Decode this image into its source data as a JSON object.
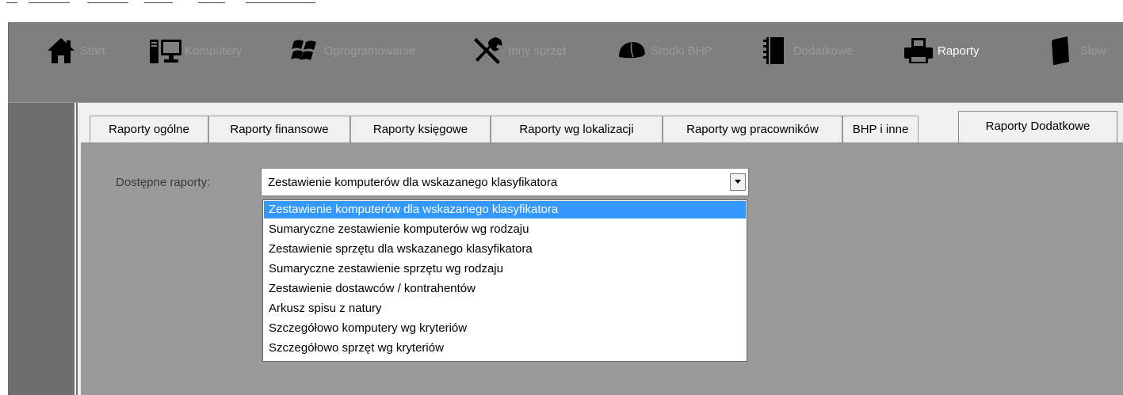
{
  "toolbar": {
    "items": [
      {
        "label": "Start",
        "icon": "home-icon",
        "active": false
      },
      {
        "label": "Komputery",
        "icon": "computer-icon",
        "active": false
      },
      {
        "label": "Oprogramowanie",
        "icon": "windows-icon",
        "active": false
      },
      {
        "label": "Inny sprzęt",
        "icon": "tools-icon",
        "active": false
      },
      {
        "label": "Środki BHP",
        "icon": "helmet-icon",
        "active": false
      },
      {
        "label": "Dodatkowe",
        "icon": "notebook-icon",
        "active": false
      },
      {
        "label": "Raporty",
        "icon": "printer-icon",
        "active": true
      },
      {
        "label": "Słow",
        "icon": "book-icon",
        "active": false
      }
    ]
  },
  "tabs": [
    {
      "label": "Raporty ogólne",
      "active": false
    },
    {
      "label": "Raporty finansowe",
      "active": false
    },
    {
      "label": "Raporty księgowe",
      "active": false
    },
    {
      "label": "Raporty wg lokalizacji",
      "active": false
    },
    {
      "label": "Raporty wg pracowników",
      "active": false
    },
    {
      "label": "BHP i inne",
      "active": false
    },
    {
      "label": "Raporty Dodatkowe",
      "active": true
    }
  ],
  "form": {
    "reports_label": "Dostępne raporty:",
    "selected_report": "Zestawienie komputerów dla wskazanego klasyfikatora",
    "options": [
      "Zestawienie komputerów dla wskazanego klasyfikatora",
      "Sumaryczne zestawienie komputerów wg rodzaju",
      "Zestawienie sprzętu dla wskazanego klasyfikatora",
      "Sumaryczne zestawienie sprzętu wg rodzaju",
      "Zestawienie dostawców / kontrahentów",
      "Arkusz spisu z natury",
      "Szczegółowo komputery wg kryteriów",
      "Szczegółowo sprzęt wg kryteriów"
    ],
    "highlighted_index": 0
  },
  "colors": {
    "toolbar_bg": "#7f7f7f",
    "active_label": "#ffffff",
    "inactive_label": "#9a9a9a",
    "selection": "#3399ff"
  }
}
